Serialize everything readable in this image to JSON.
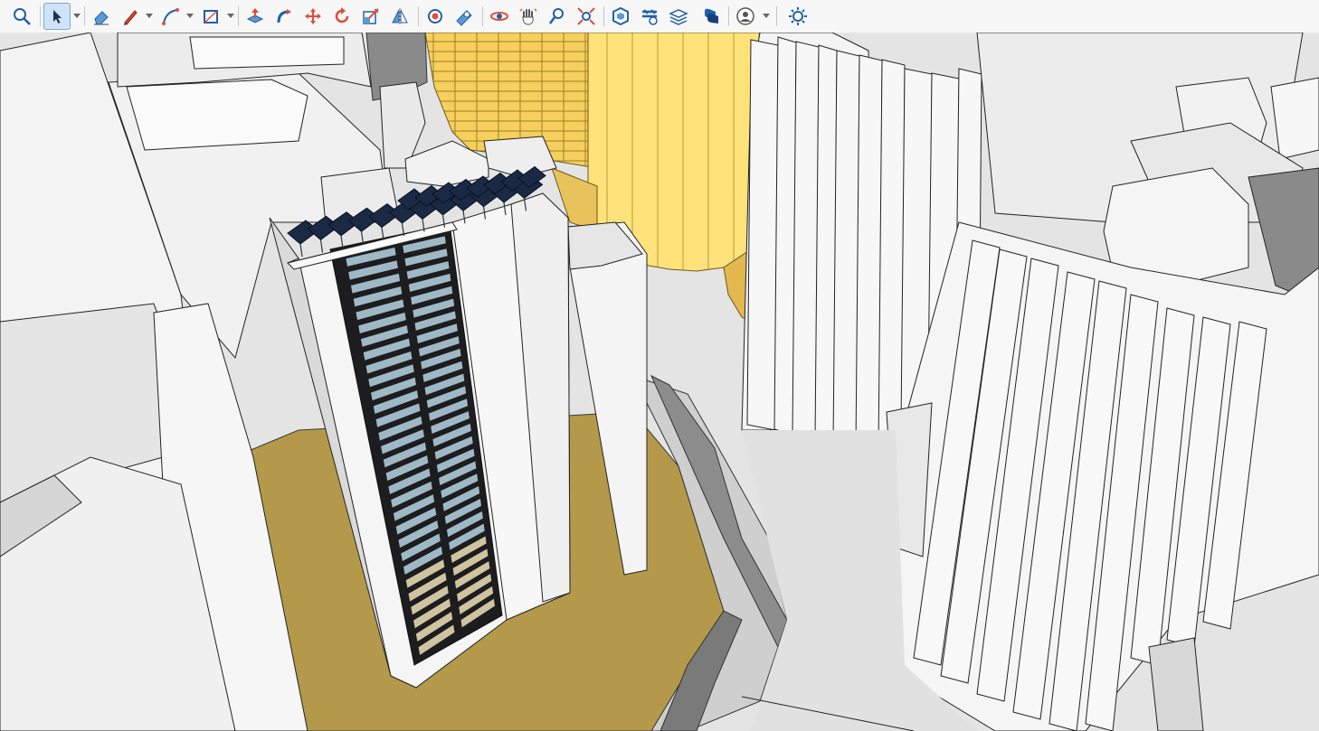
{
  "toolbar": {
    "tools": [
      {
        "id": "zoom-extents",
        "icon": "magnifier-icon",
        "active": false
      },
      {
        "id": "select",
        "icon": "cursor-arrow-icon",
        "active": true
      },
      {
        "id": "eraser",
        "icon": "eraser-icon",
        "active": false
      },
      {
        "id": "line",
        "icon": "pencil-icon",
        "active": false
      },
      {
        "id": "arc",
        "icon": "arc-icon",
        "active": false
      },
      {
        "id": "rectangle",
        "icon": "rectangle-icon",
        "active": false
      },
      {
        "id": "push-pull",
        "icon": "push-pull-icon",
        "active": false
      },
      {
        "id": "follow-me",
        "icon": "follow-me-icon",
        "active": false
      },
      {
        "id": "move",
        "icon": "move-arrows-icon",
        "active": false
      },
      {
        "id": "rotate",
        "icon": "rotate-icon",
        "active": false
      },
      {
        "id": "scale",
        "icon": "scale-icon",
        "active": false
      },
      {
        "id": "flip",
        "icon": "flip-icon",
        "active": false
      },
      {
        "id": "paint-bucket",
        "icon": "paint-bucket-icon",
        "active": false
      },
      {
        "id": "tape-measure",
        "icon": "tape-measure-icon",
        "active": false
      },
      {
        "id": "orbit",
        "icon": "orbit-icon",
        "active": false
      },
      {
        "id": "pan",
        "icon": "hand-icon",
        "active": false
      },
      {
        "id": "zoom",
        "icon": "zoom-icon",
        "active": false
      },
      {
        "id": "zoom-window",
        "icon": "zoom-extents-icon",
        "active": false
      },
      {
        "id": "warehouse",
        "icon": "warehouse-icon",
        "active": false
      },
      {
        "id": "extension-warehouse",
        "icon": "extension-warehouse-icon",
        "active": false
      },
      {
        "id": "layers",
        "icon": "layers-icon",
        "active": false
      },
      {
        "id": "styles",
        "icon": "styles-icon",
        "active": false
      },
      {
        "id": "account",
        "icon": "account-icon",
        "active": false
      },
      {
        "id": "shadows",
        "icon": "sun-icon",
        "active": false
      }
    ]
  },
  "scene": {
    "accent_colors": {
      "highlight_building": "#ffe27a",
      "ground_ochre": "#b4994a",
      "glass": "#9fb8c6",
      "solar_panel": "#1b2a44",
      "selection_blue": "#2b6cb0"
    }
  }
}
